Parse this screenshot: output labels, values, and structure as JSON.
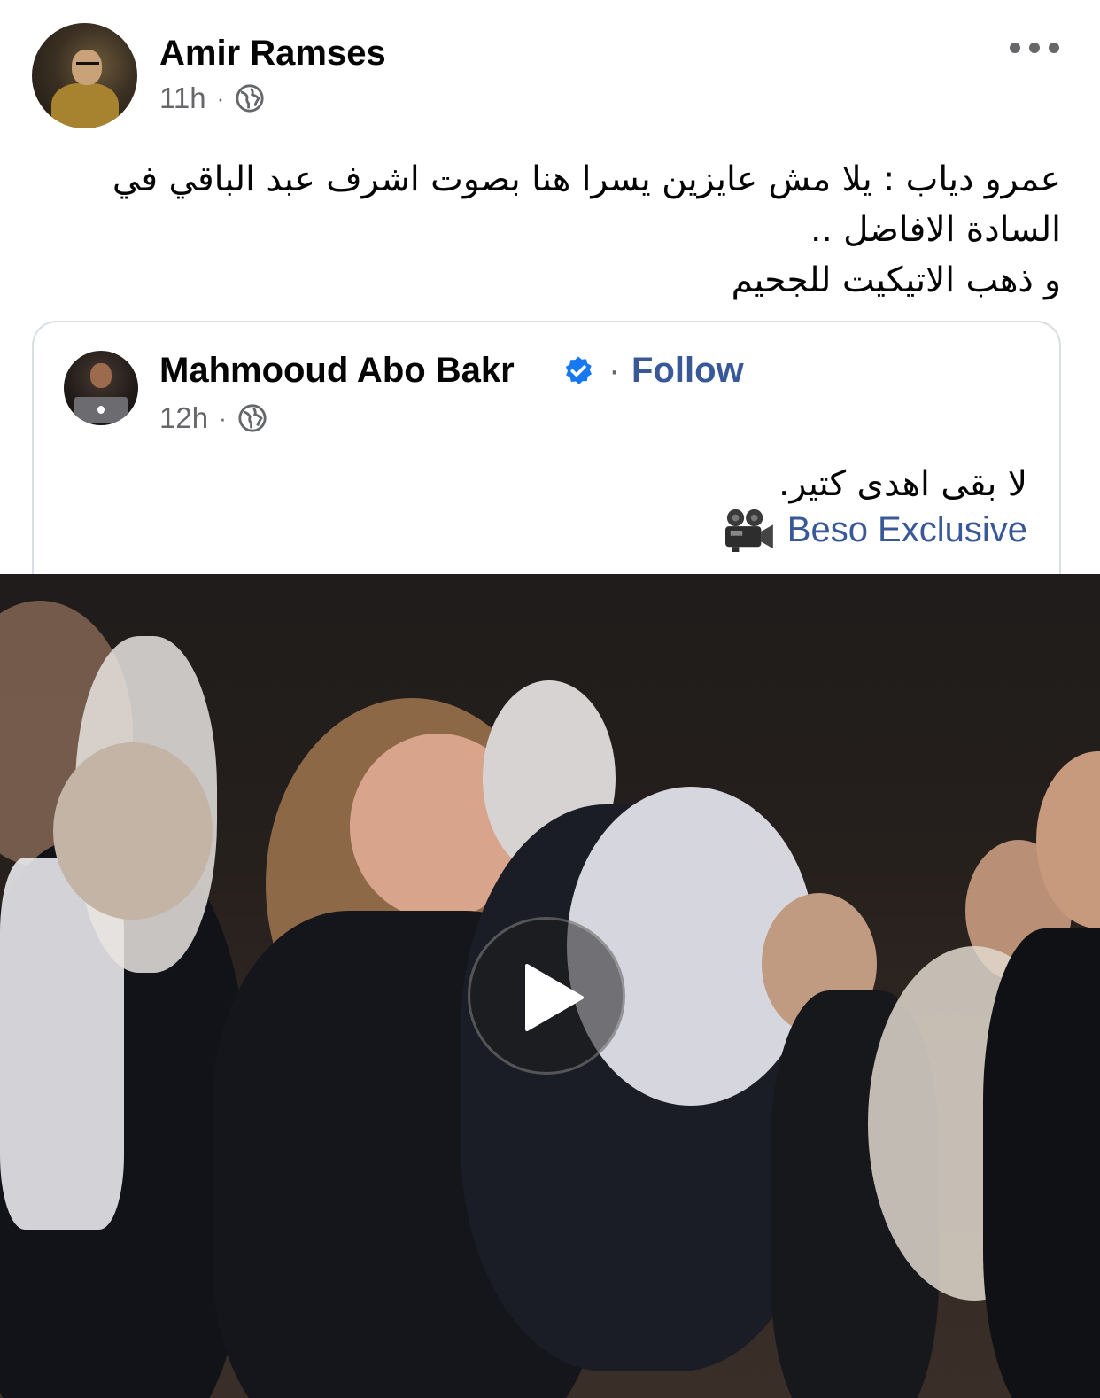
{
  "post": {
    "author": "Amir Ramses",
    "time": "11h",
    "separator": "·",
    "text_lines": [
      "عمرو دياب : يلا مش عايزين يسرا هنا بصوت اشرف عبد الباقي في",
      "السادة الافاضل ..",
      "و ذهب الاتيكيت للجحيم"
    ]
  },
  "shared": {
    "author": "Mahmooud Abo Bakr",
    "follow_separator": "·",
    "follow_label": "Follow",
    "time": "12h",
    "separator": "·",
    "text": "لا بقى اهدى كتير.",
    "source": "Beso Exclusive"
  },
  "colors": {
    "link": "#385898",
    "meta": "#65676b",
    "verified": "#1877f2"
  },
  "icons": [
    "more-icon",
    "globe-icon",
    "verified-badge-icon",
    "movie-camera-icon",
    "play-icon"
  ]
}
